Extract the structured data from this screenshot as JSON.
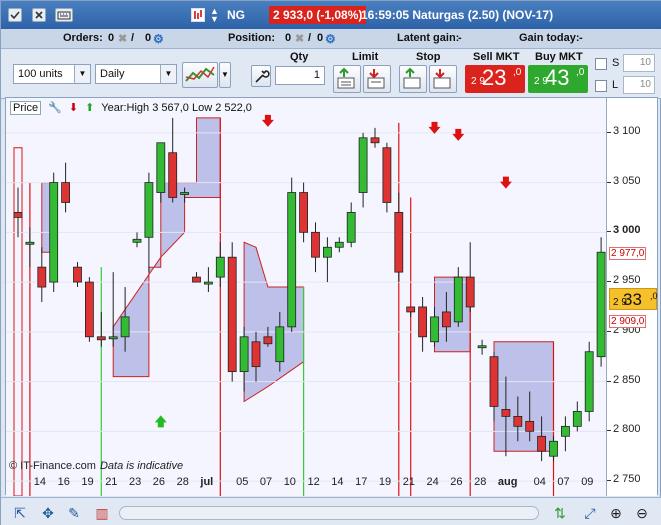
{
  "titlebar": {
    "symbol": "NG",
    "quote": "2 933,0 (-1,08%)",
    "info": "16:59:05 Naturgas (2.50) (NOV-17)"
  },
  "positions": {
    "orders_label": "Orders:",
    "orders_value1": "0",
    "orders_value2": "0",
    "position_label": "Position:",
    "position_value1": "0",
    "position_value2": "0",
    "latent_label": "Latent gain:",
    "latent_value": "-",
    "gain_label": "Gain today:",
    "gain_value": "-"
  },
  "toolbar": {
    "units": "100 units",
    "period": "Daily",
    "qty_label": "Qty",
    "qty_value": "1",
    "limit_label": "Limit",
    "stop_label": "Stop",
    "sell_label": "Sell MKT",
    "sell_small": "2 9",
    "sell_big": "23",
    "sell_sup": ",0",
    "buy_label": "Buy MKT",
    "buy_small": "2 9",
    "buy_big": "43",
    "buy_sup": ",0",
    "s_label": "S",
    "s_value": "10",
    "l_label": "L",
    "l_value": "10"
  },
  "chart": {
    "price_label": "Price",
    "year_info": "Year:High 3 567,0 Low 2 522,0",
    "watermark": "© IT-Finance.com",
    "indicative": "Data is indicative",
    "price_ticks": [
      "3 100",
      "3 050",
      "3 000",
      "2 950",
      "2 900",
      "2 850",
      "2 800",
      "2 750"
    ],
    "level_high": "2 977,0",
    "level_low": "2 909,0",
    "last_small": "2 9",
    "last_big": "33",
    "last_sup": ",0",
    "time_labels": [
      "14",
      "16",
      "19",
      "21",
      "23",
      "26",
      "28",
      "jul",
      "05",
      "07",
      "10",
      "12",
      "14",
      "17",
      "19",
      "21",
      "24",
      "26",
      "28",
      "aug",
      "04",
      "07",
      "09"
    ],
    "colors": {
      "up": "#33bb33",
      "down": "#dd3333",
      "cloud": "#8f93d6",
      "stop_line_red": "#dd1111",
      "stop_line_green": "#33cc33"
    }
  },
  "chart_data": {
    "type": "candlestick",
    "ylim": [
      2735,
      3135
    ],
    "candles": [
      {
        "o": 3020,
        "h": 3045,
        "l": 2995,
        "c": 3015
      },
      {
        "o": 2990,
        "h": 3005,
        "l": 2965,
        "c": 2990
      },
      {
        "o": 2965,
        "h": 2985,
        "l": 2930,
        "c": 2945
      },
      {
        "o": 2950,
        "h": 3060,
        "l": 2940,
        "c": 3050
      },
      {
        "o": 3050,
        "h": 3070,
        "l": 3020,
        "c": 3030
      },
      {
        "o": 2965,
        "h": 2970,
        "l": 2945,
        "c": 2950
      },
      {
        "o": 2950,
        "h": 2955,
        "l": 2890,
        "c": 2895
      },
      {
        "o": 2895,
        "h": 2920,
        "l": 2885,
        "c": 2892
      },
      {
        "o": 2893,
        "h": 2960,
        "l": 2885,
        "c": 2895
      },
      {
        "o": 2895,
        "h": 2945,
        "l": 2880,
        "c": 2915
      },
      {
        "o": 2990,
        "h": 3000,
        "l": 2985,
        "c": 2993
      },
      {
        "o": 2995,
        "h": 3060,
        "l": 2960,
        "c": 3050
      },
      {
        "o": 3040,
        "h": 3085,
        "l": 3030,
        "c": 3090
      },
      {
        "o": 3080,
        "h": 3115,
        "l": 3030,
        "c": 3035
      },
      {
        "o": 3038,
        "h": 3045,
        "l": 3030,
        "c": 3040
      },
      {
        "o": 2955,
        "h": 2960,
        "l": 2950,
        "c": 2950
      },
      {
        "o": 2950,
        "h": 2965,
        "l": 2940,
        "c": 2950
      },
      {
        "o": 2955,
        "h": 2990,
        "l": 2945,
        "c": 2975
      },
      {
        "o": 2975,
        "h": 2990,
        "l": 2850,
        "c": 2860
      },
      {
        "o": 2860,
        "h": 2905,
        "l": 2840,
        "c": 2895
      },
      {
        "o": 2890,
        "h": 2900,
        "l": 2850,
        "c": 2865
      },
      {
        "o": 2895,
        "h": 2905,
        "l": 2885,
        "c": 2888
      },
      {
        "o": 2870,
        "h": 2920,
        "l": 2860,
        "c": 2905
      },
      {
        "o": 2905,
        "h": 3055,
        "l": 2900,
        "c": 3040
      },
      {
        "o": 3040,
        "h": 3050,
        "l": 2990,
        "c": 3000
      },
      {
        "o": 3000,
        "h": 3010,
        "l": 2960,
        "c": 2975
      },
      {
        "o": 2975,
        "h": 2995,
        "l": 2950,
        "c": 2985
      },
      {
        "o": 2985,
        "h": 2995,
        "l": 2980,
        "c": 2990
      },
      {
        "o": 2990,
        "h": 3030,
        "l": 2985,
        "c": 3020
      },
      {
        "o": 3040,
        "h": 3100,
        "l": 3025,
        "c": 3095
      },
      {
        "o": 3095,
        "h": 3105,
        "l": 3085,
        "c": 3090
      },
      {
        "o": 3085,
        "h": 3090,
        "l": 3020,
        "c": 3030
      },
      {
        "o": 3020,
        "h": 3040,
        "l": 2950,
        "c": 2960
      },
      {
        "o": 2925,
        "h": 2925,
        "l": 2915,
        "c": 2920
      },
      {
        "o": 2925,
        "h": 2935,
        "l": 2880,
        "c": 2895
      },
      {
        "o": 2890,
        "h": 2925,
        "l": 2885,
        "c": 2915
      },
      {
        "o": 2920,
        "h": 2940,
        "l": 2890,
        "c": 2905
      },
      {
        "o": 2910,
        "h": 2965,
        "l": 2905,
        "c": 2955
      },
      {
        "o": 2955,
        "h": 2990,
        "l": 2920,
        "c": 2925
      },
      {
        "o": 2885,
        "h": 2892,
        "l": 2877,
        "c": 2886
      },
      {
        "o": 2875,
        "h": 2880,
        "l": 2810,
        "c": 2825
      },
      {
        "o": 2822,
        "h": 2855,
        "l": 2775,
        "c": 2815
      },
      {
        "o": 2815,
        "h": 2835,
        "l": 2790,
        "c": 2805
      },
      {
        "o": 2810,
        "h": 2840,
        "l": 2790,
        "c": 2800
      },
      {
        "o": 2795,
        "h": 2815,
        "l": 2770,
        "c": 2780
      },
      {
        "o": 2775,
        "h": 2795,
        "l": 2770,
        "c": 2790
      },
      {
        "o": 2795,
        "h": 2815,
        "l": 2780,
        "c": 2805
      },
      {
        "o": 2805,
        "h": 2830,
        "l": 2800,
        "c": 2820
      },
      {
        "o": 2820,
        "h": 2890,
        "l": 2810,
        "c": 2880
      },
      {
        "o": 2875,
        "h": 2995,
        "l": 2865,
        "c": 2980
      }
    ]
  }
}
